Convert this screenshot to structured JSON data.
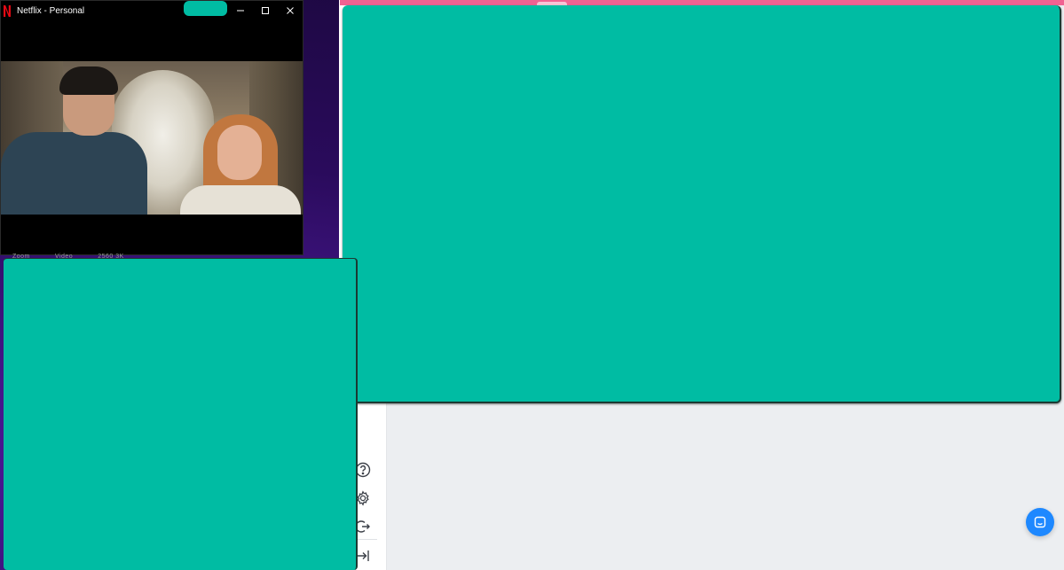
{
  "netflix_window": {
    "title": "Netflix - Personal",
    "controls": {
      "minimize_icon": "minimize-icon",
      "maximize_icon": "maximize-icon",
      "close_icon": "close-icon"
    },
    "below_video_text": [
      "Zoom",
      "Video",
      "2560 3K"
    ]
  },
  "app_window": {
    "accent_color": "#f06292",
    "sidebar": {
      "icons": [
        "help-icon",
        "settings-icon",
        "logout-icon",
        "collapse-sidebar-icon"
      ]
    },
    "chat_button_icon": "chat-icon",
    "chat_button_color": "#1e88ff"
  },
  "redaction_color": "#00bca3"
}
